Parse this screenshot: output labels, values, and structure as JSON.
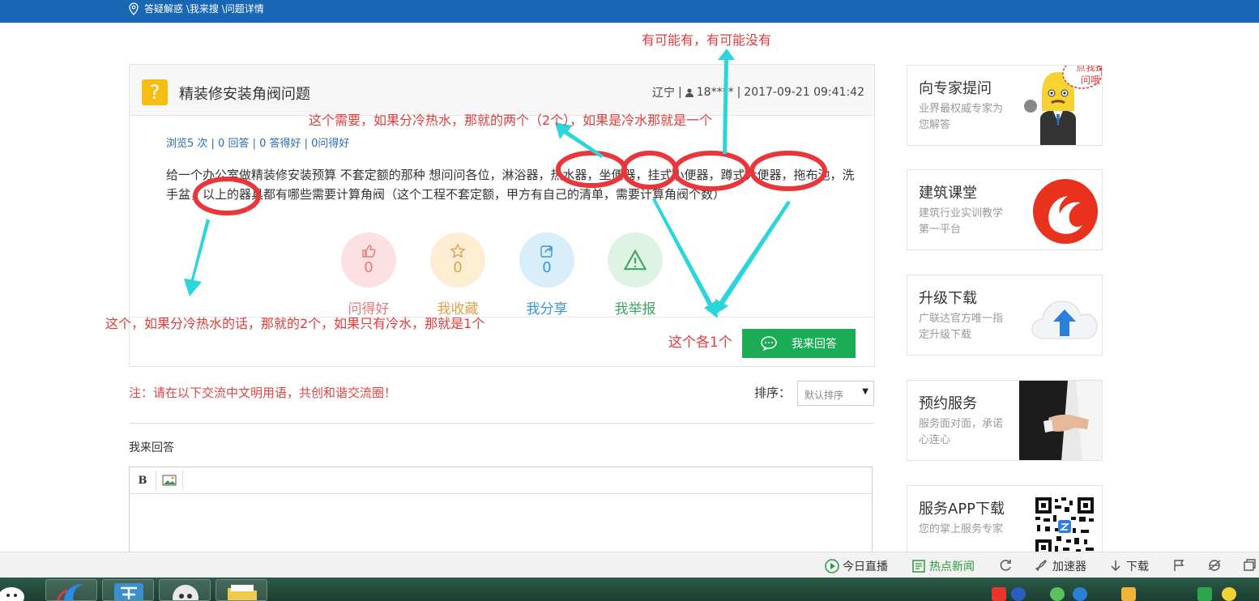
{
  "breadcrumb": "答疑解惑 \\我来搜 \\问题详情",
  "question": {
    "title": "精装修安装角阀问题",
    "region": "辽宁",
    "user": "18****",
    "datetime": "2017-09-21 09:41:42",
    "stats": "浏览5 次 | 0 回答 | 0 答得好 | 0问得好",
    "body": "给一个办公室做精装修安装预算 不套定额的那种 想问问各位，淋浴器，热水器，坐便器，挂式小便器，蹲式大便器，拖布池，洗手盆，以上的器具都有哪些需要计算角阀（这个工程不套定额，甲方有自己的清单，需要计算角阀个数）"
  },
  "actions": [
    {
      "label": "问得好",
      "count": "0",
      "icon": "thumbs-up-icon",
      "color": "#e57a7a",
      "bg": "#fde0e2"
    },
    {
      "label": "我收藏",
      "count": "0",
      "icon": "star-icon",
      "color": "#e0a24a",
      "bg": "#fdedd3"
    },
    {
      "label": "我分享",
      "count": "0",
      "icon": "share-icon",
      "color": "#3b94d8",
      "bg": "#d9eefb"
    },
    {
      "label": "我举报",
      "count": "",
      "icon": "warning-icon",
      "color": "#3fa660",
      "bg": "#ddf3e4"
    }
  ],
  "answer_button": "我来回答",
  "note": "注：请在以下交流中文明用语，共创和谐交流圈！",
  "sort": {
    "label": "排序：",
    "value": "默认排序"
  },
  "my_answer_label": "我来回答",
  "editor": {
    "bold": "B"
  },
  "sidebar": [
    {
      "title": "向专家提问",
      "desc": "业界最权威专家为您解答",
      "bubble": "点我提问哦"
    },
    {
      "title": "建筑课堂",
      "desc": "建筑行业实训教学第一平台"
    },
    {
      "title": "升级下载",
      "desc": "广联达官方唯一指定升级下载"
    },
    {
      "title": "预约服务",
      "desc": "服务面对面，承诺心连心"
    },
    {
      "title": "服务APP下载",
      "desc": "您的掌上服务专家"
    }
  ],
  "annotations": {
    "top": "有可能有，有可能没有",
    "middle": "这个需要，如果分冷热水，那就的两个（2个），如果是冷水那就是一个",
    "left": "这个，如果分冷热水的话，那就的2个，如果只有冷水，那就是1个",
    "bottom": "这个各1个"
  },
  "statusbar": [
    {
      "label": "今日直播",
      "icon": "play-icon",
      "color": "#333"
    },
    {
      "label": "热点新闻",
      "icon": "news-icon",
      "color": "#2a9a3a"
    },
    {
      "label": "加速器",
      "icon": "rocket-icon",
      "color": "#333"
    },
    {
      "label": "下载",
      "icon": "download-icon",
      "color": "#333"
    }
  ]
}
